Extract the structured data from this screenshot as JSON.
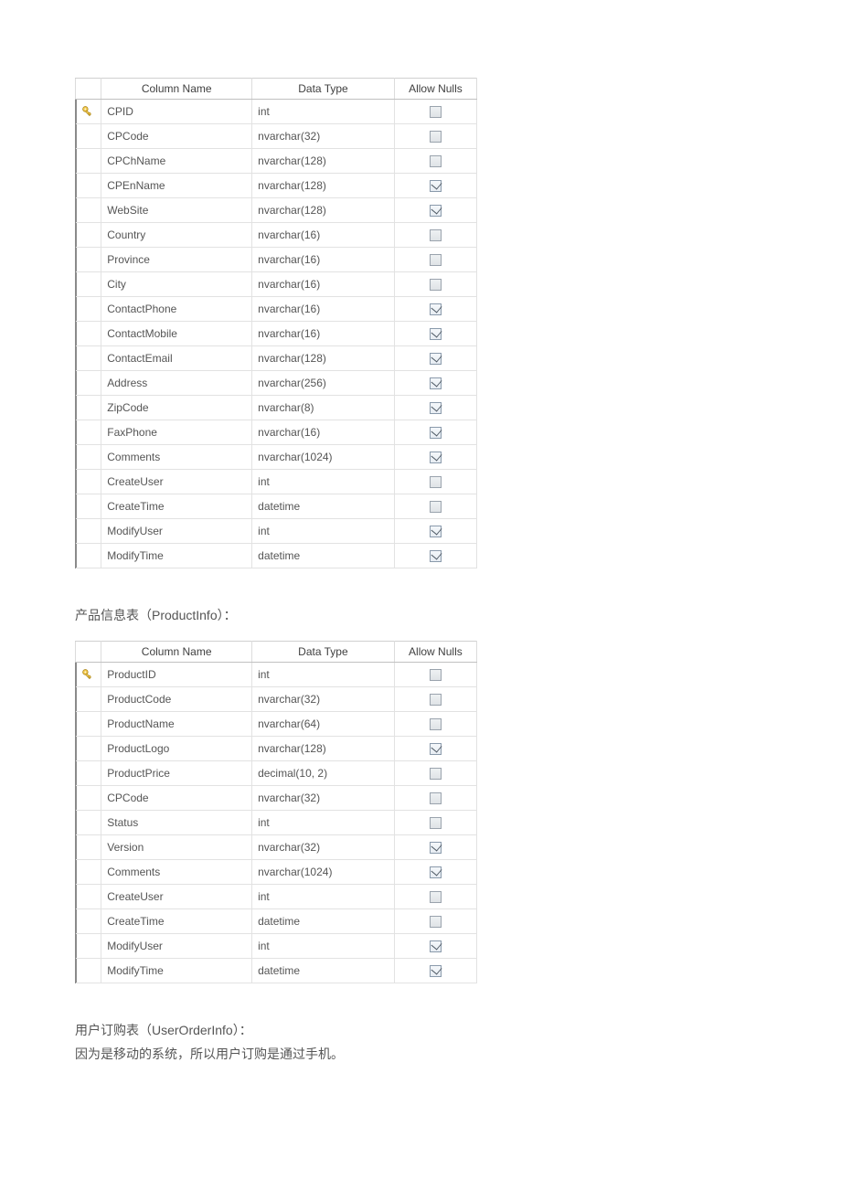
{
  "headers": {
    "column_name": "Column Name",
    "data_type": "Data Type",
    "allow_nulls": "Allow Nulls"
  },
  "table1": {
    "rows": [
      {
        "icon": "key-icon",
        "name": "CPID",
        "type": "int",
        "nullable": false
      },
      {
        "icon": "",
        "name": "CPCode",
        "type": "nvarchar(32)",
        "nullable": false
      },
      {
        "icon": "",
        "name": "CPChName",
        "type": "nvarchar(128)",
        "nullable": false
      },
      {
        "icon": "",
        "name": "CPEnName",
        "type": "nvarchar(128)",
        "nullable": true
      },
      {
        "icon": "",
        "name": "WebSite",
        "type": "nvarchar(128)",
        "nullable": true
      },
      {
        "icon": "",
        "name": "Country",
        "type": "nvarchar(16)",
        "nullable": false
      },
      {
        "icon": "",
        "name": "Province",
        "type": "nvarchar(16)",
        "nullable": false
      },
      {
        "icon": "",
        "name": "City",
        "type": "nvarchar(16)",
        "nullable": false
      },
      {
        "icon": "",
        "name": "ContactPhone",
        "type": "nvarchar(16)",
        "nullable": true
      },
      {
        "icon": "",
        "name": "ContactMobile",
        "type": "nvarchar(16)",
        "nullable": true
      },
      {
        "icon": "",
        "name": "ContactEmail",
        "type": "nvarchar(128)",
        "nullable": true
      },
      {
        "icon": "",
        "name": "Address",
        "type": "nvarchar(256)",
        "nullable": true
      },
      {
        "icon": "",
        "name": "ZipCode",
        "type": "nvarchar(8)",
        "nullable": true
      },
      {
        "icon": "",
        "name": "FaxPhone",
        "type": "nvarchar(16)",
        "nullable": true
      },
      {
        "icon": "",
        "name": "Comments",
        "type": "nvarchar(1024)",
        "nullable": true
      },
      {
        "icon": "",
        "name": "CreateUser",
        "type": "int",
        "nullable": false
      },
      {
        "icon": "",
        "name": "CreateTime",
        "type": "datetime",
        "nullable": false
      },
      {
        "icon": "",
        "name": "ModifyUser",
        "type": "int",
        "nullable": true
      },
      {
        "icon": "",
        "name": "ModifyTime",
        "type": "datetime",
        "nullable": true
      }
    ]
  },
  "caption1": {
    "prefix": "产品信息表（",
    "id": "ProductInfo",
    "suffix": "）："
  },
  "table2": {
    "rows": [
      {
        "icon": "key-icon",
        "name": "ProductID",
        "type": "int",
        "nullable": false
      },
      {
        "icon": "",
        "name": "ProductCode",
        "type": "nvarchar(32)",
        "nullable": false
      },
      {
        "icon": "",
        "name": "ProductName",
        "type": "nvarchar(64)",
        "nullable": false
      },
      {
        "icon": "",
        "name": "ProductLogo",
        "type": "nvarchar(128)",
        "nullable": true
      },
      {
        "icon": "",
        "name": "ProductPrice",
        "type": "decimal(10, 2)",
        "nullable": false
      },
      {
        "icon": "",
        "name": "CPCode",
        "type": "nvarchar(32)",
        "nullable": false
      },
      {
        "icon": "",
        "name": "Status",
        "type": "int",
        "nullable": false
      },
      {
        "icon": "",
        "name": "Version",
        "type": "nvarchar(32)",
        "nullable": true
      },
      {
        "icon": "",
        "name": "Comments",
        "type": "nvarchar(1024)",
        "nullable": true
      },
      {
        "icon": "",
        "name": "CreateUser",
        "type": "int",
        "nullable": false
      },
      {
        "icon": "",
        "name": "CreateTime",
        "type": "datetime",
        "nullable": false
      },
      {
        "icon": "",
        "name": "ModifyUser",
        "type": "int",
        "nullable": true
      },
      {
        "icon": "",
        "name": "ModifyTime",
        "type": "datetime",
        "nullable": true
      }
    ]
  },
  "caption2": {
    "line1_prefix": "用户订购表（",
    "line1_id": "UserOrderInfo",
    "line1_suffix": "）：",
    "line2": "因为是移动的系统，所以用户订购是通过手机。"
  }
}
